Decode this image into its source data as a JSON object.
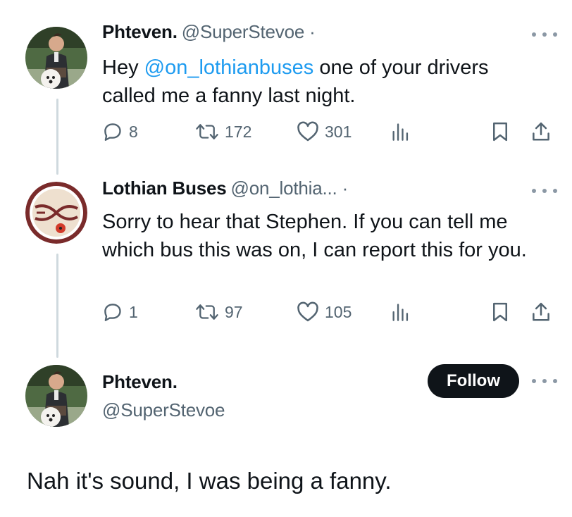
{
  "colors": {
    "text": "#0f1419",
    "muted": "#536471",
    "link": "#1d9bf0",
    "thread_line": "#cfd9de",
    "follow_bg": "#0f1419"
  },
  "tweets": [
    {
      "name": "Phteven.",
      "handle": "@SuperStevoe",
      "dot": "·",
      "avatar": "user-photo-avatar",
      "text_prefix": "Hey ",
      "mention": "@on_lothianbuses",
      "text_line1_rest": " one of your drivers",
      "text_line2": "called me a fanny last night.",
      "replies": "8",
      "reposts": "172",
      "likes": "301"
    },
    {
      "name": "Lothian Buses",
      "handle": "@on_lothia...",
      "dot": "·",
      "avatar": "lothian-buses-logo-avatar",
      "text": "Sorry to hear that Stephen. If you can tell me which bus this was on, I can report this for you.",
      "replies": "1",
      "reposts": "97",
      "likes": "105"
    }
  ],
  "main_tweet": {
    "name": "Phteven.",
    "handle": "@SuperStevoe",
    "follow_label": "Follow",
    "text": "Nah it's sound, I was being a fanny."
  }
}
